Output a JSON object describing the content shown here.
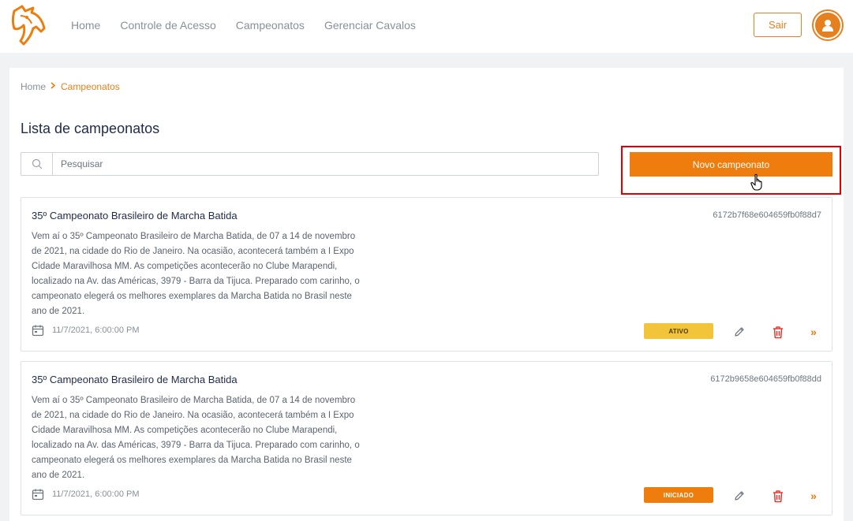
{
  "header": {
    "logo_icon": "horse-head-logo-icon",
    "nav": [
      "Home",
      "Controle de Acesso",
      "Campeonatos",
      "Gerenciar Cavalos"
    ],
    "logout_label": "Sair",
    "avatar_icon": "user-avatar-icon"
  },
  "breadcrumb": {
    "home": "Home",
    "separator_icon": "chevron-right-icon",
    "current": "Campeonatos"
  },
  "page_title": "Lista de campeonatos",
  "search": {
    "placeholder": "Pesquisar",
    "value": "",
    "icon": "search-icon"
  },
  "new_button_label": "Novo campeonato",
  "colors": {
    "accent": "#ee7d0d",
    "highlight_frame": "#e00000",
    "badge_ativo": "#f2c43a",
    "badge_iniciado": "#ee7d0d",
    "delete_icon": "#e53935"
  },
  "championships": [
    {
      "title": "35º Campeonato Brasileiro de Marcha Batida",
      "id": "6172b7f68e604659fb0f88d7",
      "description": "Vem aí o 35º Campeonato Brasileiro de Marcha Batida, de 07 a 14 de novembro de 2021, na cidade do Rio de Janeiro. Na ocasião, acontecerá também a I Expo Cidade Maravilhosa MM. As competições acontecerão no Clube Marapendi, localizado na Av. das Américas, 3979 - Barra da Tijuca. Preparado com carinho, o campeonato elegerá os melhores exemplares da Marcha Batida no Brasil neste ano de 2021.",
      "date": "11/7/2021, 6:00:00 PM",
      "status": "ATIVO"
    },
    {
      "title": "35º Campeonato Brasileiro de Marcha Batida",
      "id": "6172b9658e604659fb0f88dd",
      "description": "Vem aí o 35º Campeonato Brasileiro de Marcha Batida, de 07 a 14 de novembro de 2021, na cidade do Rio de Janeiro. Na ocasião, acontecerá também a I Expo Cidade Maravilhosa MM. As competições acontecerão no Clube Marapendi, localizado na Av. das Américas, 3979 - Barra da Tijuca. Preparado com carinho, o campeonato elegerá os melhores exemplares da Marcha Batida no Brasil neste ano de 2021.",
      "date": "11/7/2021, 6:00:00 PM",
      "status": "INICIADO"
    }
  ],
  "card_actions": {
    "calendar_icon": "calendar-icon",
    "edit_icon": "pencil-edit-icon",
    "delete_icon": "trash-delete-icon",
    "more_icon": "double-chevron-right-icon",
    "more_glyph": "»"
  }
}
